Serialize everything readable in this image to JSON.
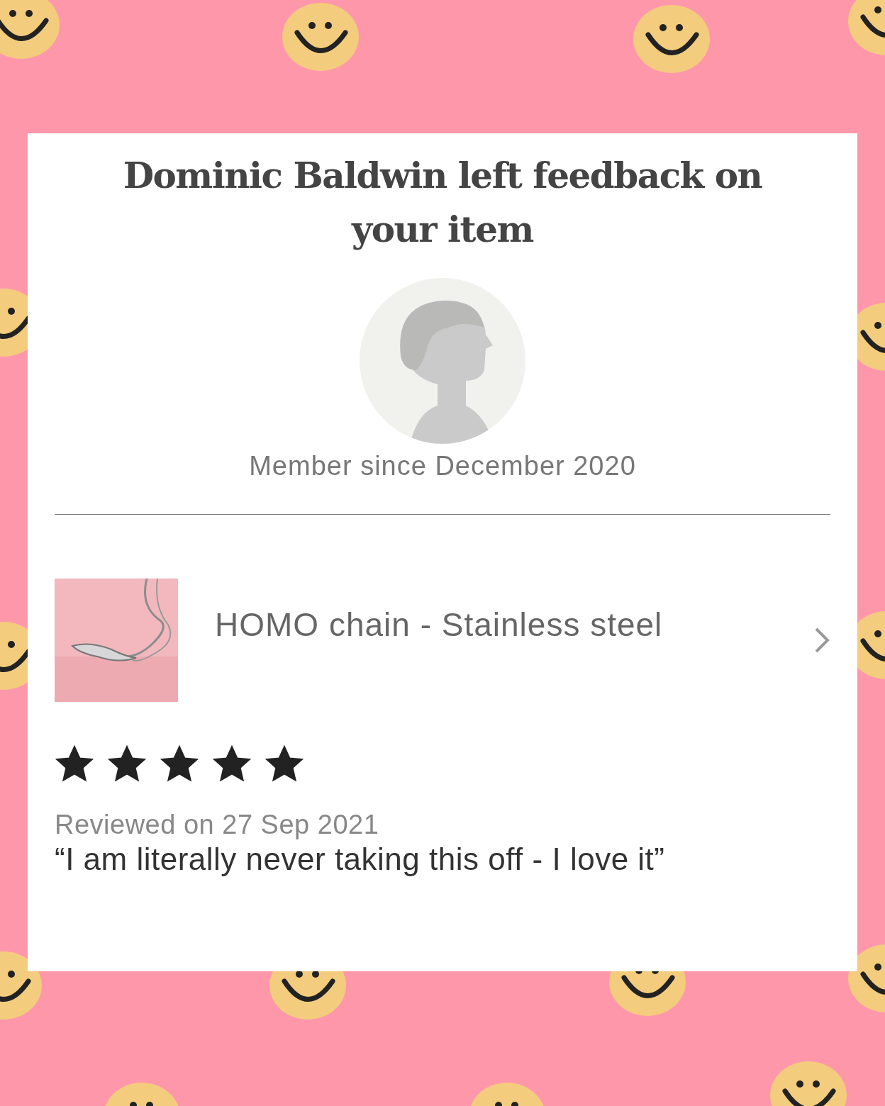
{
  "review_card": {
    "title": "Dominic Baldwin left feedback on your item",
    "member_since": "Member since December 2020",
    "item": {
      "name": "HOMO chain - Stainless steel"
    },
    "stars": 5,
    "reviewed_on": "Reviewed on 27 Sep 2021",
    "comment": "“I am literally never taking this off - I love it”"
  }
}
